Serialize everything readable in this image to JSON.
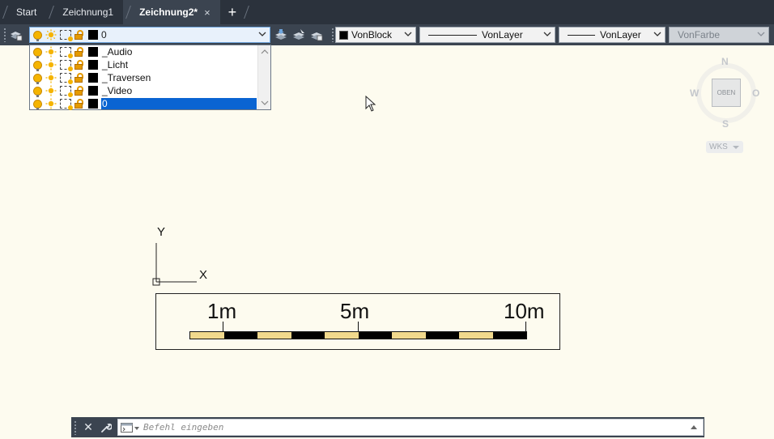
{
  "tabs": [
    {
      "label": "Start",
      "active": false,
      "close": ""
    },
    {
      "label": "Zeichnung1",
      "active": false,
      "close": ""
    },
    {
      "label": "Zeichnung2*",
      "active": true,
      "close": "×"
    }
  ],
  "tab_add": "+",
  "toolbar": {
    "current_layer": "0",
    "color": "VonBlock",
    "linetype": "VonLayer",
    "lineweight": "VonLayer",
    "plotstyle": "VonFarbe"
  },
  "layer_list": {
    "items": [
      {
        "name": "_Audio",
        "selected": false
      },
      {
        "name": "_Licht",
        "selected": false
      },
      {
        "name": "_Traversen",
        "selected": false
      },
      {
        "name": "_Video",
        "selected": false
      },
      {
        "name": "0",
        "selected": true
      }
    ]
  },
  "viewcube": {
    "north": "N",
    "south": "S",
    "west": "W",
    "east": "O",
    "top": "OBEN",
    "ucs_menu": "WKS"
  },
  "ucs_icon": {
    "x": "X",
    "y": "Y"
  },
  "scalebar": {
    "labels": [
      "1m",
      "5m",
      "10m"
    ],
    "segment_colors": [
      "#f1d98d",
      "#000000"
    ]
  },
  "command_line": {
    "placeholder": "Befehl eingeben",
    "close": "✕"
  }
}
